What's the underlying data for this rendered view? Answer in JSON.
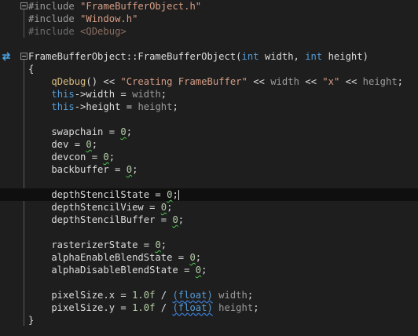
{
  "colors": {
    "background": "#1e1e1e",
    "preprocessor": "#9b9b9b",
    "string": "#d69d85",
    "keyword": "#569cd6",
    "function": "#d7ba7d",
    "text": "#dcdcdc",
    "number": "#b5cea8"
  },
  "lines": [
    {
      "fold": true,
      "tokens": [
        {
          "t": "#include ",
          "c": "pre"
        },
        {
          "t": "\"FrameBufferObject.h\"",
          "c": "str"
        }
      ]
    },
    {
      "tokens": [
        {
          "t": "#include ",
          "c": "pre"
        },
        {
          "t": "\"Window.h\"",
          "c": "str"
        }
      ]
    },
    {
      "tokens": [
        {
          "t": "#include ",
          "c": "pre-dim"
        },
        {
          "t": "<QDebug>",
          "c": "str-dim"
        }
      ]
    },
    {
      "tokens": []
    },
    {
      "fold": true,
      "icon": "swap-icon",
      "tokens": [
        {
          "t": "FrameBufferObject::FrameBufferObject(",
          "c": "txt"
        },
        {
          "t": "int",
          "c": "kw"
        },
        {
          "t": " width, ",
          "c": "txt"
        },
        {
          "t": "int",
          "c": "kw"
        },
        {
          "t": " height)",
          "c": "txt"
        }
      ]
    },
    {
      "tokens": [
        {
          "t": "{",
          "c": "txt"
        }
      ]
    },
    {
      "tokens": [
        {
          "t": "    ",
          "c": "txt"
        },
        {
          "t": "qDebug",
          "c": "fn"
        },
        {
          "t": "() << ",
          "c": "txt"
        },
        {
          "t": "\"Creating FrameBuffer\"",
          "c": "str"
        },
        {
          "t": " << ",
          "c": "txt"
        },
        {
          "t": "width",
          "c": "param"
        },
        {
          "t": " << ",
          "c": "txt"
        },
        {
          "t": "\"x\"",
          "c": "str"
        },
        {
          "t": " << ",
          "c": "txt"
        },
        {
          "t": "height",
          "c": "param"
        },
        {
          "t": ";",
          "c": "txt"
        }
      ]
    },
    {
      "tokens": [
        {
          "t": "    ",
          "c": "txt"
        },
        {
          "t": "this",
          "c": "kw"
        },
        {
          "t": "->width = ",
          "c": "txt"
        },
        {
          "t": "width",
          "c": "param"
        },
        {
          "t": ";",
          "c": "txt"
        }
      ]
    },
    {
      "tokens": [
        {
          "t": "    ",
          "c": "txt"
        },
        {
          "t": "this",
          "c": "kw"
        },
        {
          "t": "->height = ",
          "c": "txt"
        },
        {
          "t": "height",
          "c": "param"
        },
        {
          "t": ";",
          "c": "txt"
        }
      ]
    },
    {
      "tokens": []
    },
    {
      "tokens": [
        {
          "t": "    swapchain = ",
          "c": "txt"
        },
        {
          "t": "0",
          "c": "num",
          "squig": true
        },
        {
          "t": ";",
          "c": "txt"
        }
      ]
    },
    {
      "tokens": [
        {
          "t": "    dev = ",
          "c": "txt"
        },
        {
          "t": "0",
          "c": "num",
          "squig": true
        },
        {
          "t": ";",
          "c": "txt"
        }
      ]
    },
    {
      "tokens": [
        {
          "t": "    devcon = ",
          "c": "txt"
        },
        {
          "t": "0",
          "c": "num",
          "squig": true
        },
        {
          "t": ";",
          "c": "txt"
        }
      ]
    },
    {
      "tokens": [
        {
          "t": "    backbuffer = ",
          "c": "txt"
        },
        {
          "t": "0",
          "c": "num",
          "squig": true
        },
        {
          "t": ";",
          "c": "txt"
        }
      ]
    },
    {
      "tokens": []
    },
    {
      "current": true,
      "caret": true,
      "tokens": [
        {
          "t": "    depthStencilState = ",
          "c": "txt"
        },
        {
          "t": "0",
          "c": "num",
          "squig": true
        },
        {
          "t": ";",
          "c": "txt"
        }
      ]
    },
    {
      "tokens": [
        {
          "t": "    depthStencilView = ",
          "c": "txt"
        },
        {
          "t": "0",
          "c": "num",
          "squig": true
        },
        {
          "t": ";",
          "c": "txt"
        }
      ]
    },
    {
      "tokens": [
        {
          "t": "    depthStencilBuffer = ",
          "c": "txt"
        },
        {
          "t": "0",
          "c": "num",
          "squig": true
        },
        {
          "t": ";",
          "c": "txt"
        }
      ]
    },
    {
      "tokens": []
    },
    {
      "tokens": [
        {
          "t": "    rasterizerState = ",
          "c": "txt"
        },
        {
          "t": "0",
          "c": "num",
          "squig": true
        },
        {
          "t": ";",
          "c": "txt"
        }
      ]
    },
    {
      "tokens": [
        {
          "t": "    alphaEnableBlendState = ",
          "c": "txt"
        },
        {
          "t": "0",
          "c": "num",
          "squig": true
        },
        {
          "t": ";",
          "c": "txt"
        }
      ]
    },
    {
      "tokens": [
        {
          "t": "    alphaDisableBlendState = ",
          "c": "txt"
        },
        {
          "t": "0",
          "c": "num",
          "squig": true
        },
        {
          "t": ";",
          "c": "txt"
        }
      ]
    },
    {
      "tokens": []
    },
    {
      "tokens": [
        {
          "t": "    pixelSize.x = ",
          "c": "txt"
        },
        {
          "t": "1.0f",
          "c": "num"
        },
        {
          "t": " / ",
          "c": "txt"
        },
        {
          "t": "(float)",
          "c": "kw",
          "squig": true
        },
        {
          "t": " ",
          "c": "txt"
        },
        {
          "t": "width",
          "c": "param"
        },
        {
          "t": ";",
          "c": "txt"
        }
      ]
    },
    {
      "tokens": [
        {
          "t": "    pixelSize.y = ",
          "c": "txt"
        },
        {
          "t": "1.0f",
          "c": "num"
        },
        {
          "t": " / ",
          "c": "txt"
        },
        {
          "t": "(float)",
          "c": "kw",
          "squig": true
        },
        {
          "t": " ",
          "c": "txt"
        },
        {
          "t": "height",
          "c": "param"
        },
        {
          "t": ";",
          "c": "txt"
        }
      ]
    },
    {
      "tokens": [
        {
          "t": "}",
          "c": "txt"
        }
      ]
    }
  ]
}
